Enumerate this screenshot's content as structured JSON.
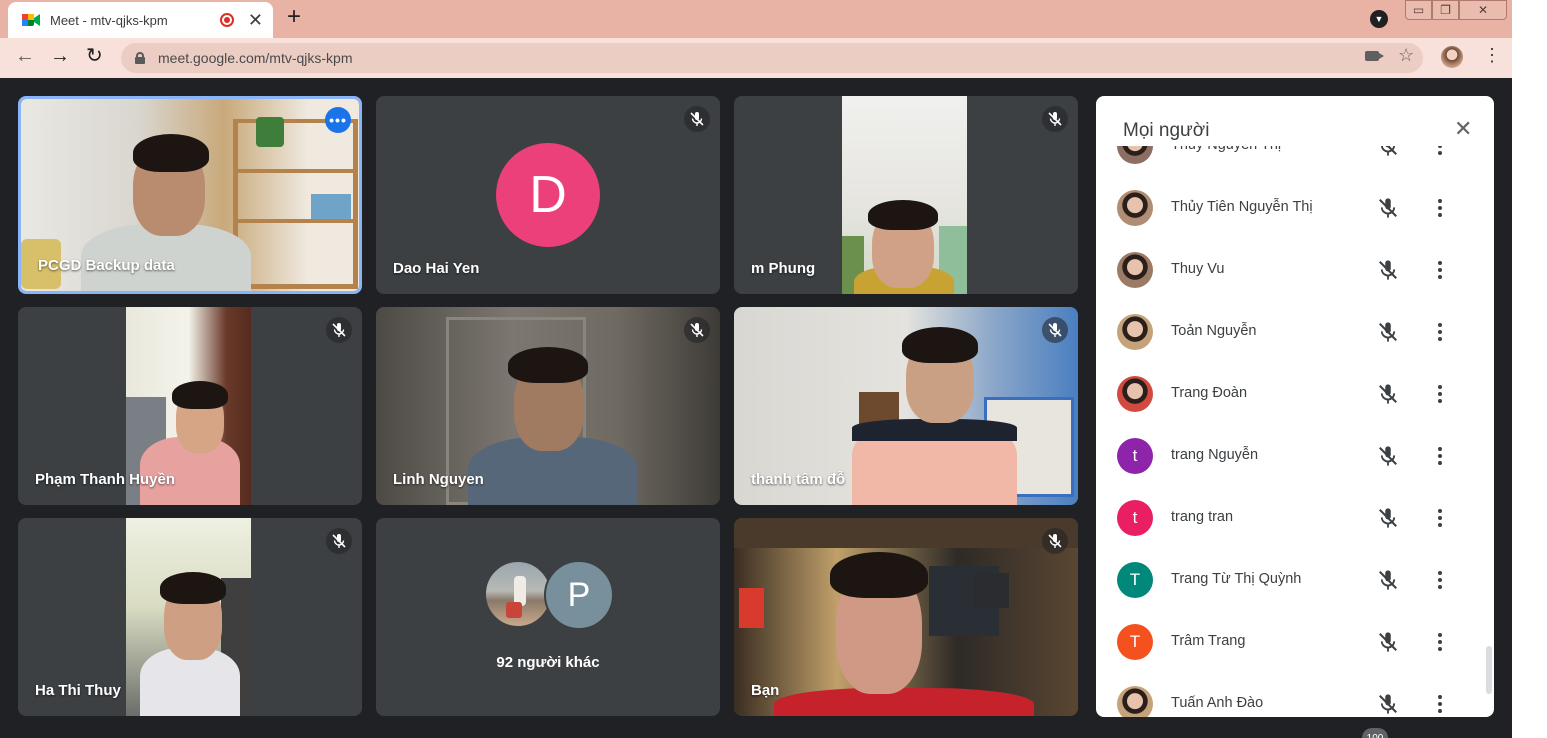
{
  "browser": {
    "tab_title": "Meet - mtv-qjks-kpm",
    "tab_close": "✕",
    "new_tab": "+",
    "url": "meet.google.com/mtv-qjks-kpm",
    "back": "←",
    "forward": "→",
    "reload": "↻",
    "star": "☆",
    "menu": "⋮",
    "win_min": "▭",
    "win_max": "❐",
    "win_close": "✕",
    "tab_search": "▼",
    "accent": "#1a73e8"
  },
  "tiles": [
    {
      "name": "PCGD Backup data",
      "active": true,
      "more": "•••"
    },
    {
      "name": "Dao Hai Yen",
      "avatar_letter": "D",
      "avatar_color": "#ec407a"
    },
    {
      "name": "m Phung"
    },
    {
      "name": "Phạm Thanh Huyền"
    },
    {
      "name": "Linh Nguyen"
    },
    {
      "name": "thanh tâm đỗ"
    },
    {
      "name": "Ha Thi Thuy"
    },
    {
      "others_label": "92 người khác",
      "avatar_letter": "P",
      "avatar_color": "#78909c"
    },
    {
      "name": "Bạn"
    }
  ],
  "people_panel": {
    "title": "Mọi người",
    "close": "✕",
    "people": [
      {
        "name": "Thủy Nguyễn Thị",
        "avatar_type": "photo"
      },
      {
        "name": "Thủy Tiên Nguyễn Thị",
        "avatar_type": "photo"
      },
      {
        "name": "Thuy Vu",
        "avatar_type": "photo"
      },
      {
        "name": "Toản Nguyễn",
        "avatar_type": "photo"
      },
      {
        "name": "Trang Đoàn",
        "avatar_type": "photo"
      },
      {
        "name": "trang Nguyễn",
        "avatar_letter": "t",
        "avatar_color": "#8e24aa"
      },
      {
        "name": "trang tran",
        "avatar_letter": "t",
        "avatar_color": "#e91e63"
      },
      {
        "name": "Trang Từ Thị Quỳnh",
        "avatar_letter": "T",
        "avatar_color": "#00897b"
      },
      {
        "name": "Trâm Trang",
        "avatar_letter": "T",
        "avatar_color": "#f4511e"
      },
      {
        "name": "Tuấn Anh Đào",
        "avatar_type": "photo"
      }
    ],
    "count_badge": "100"
  }
}
